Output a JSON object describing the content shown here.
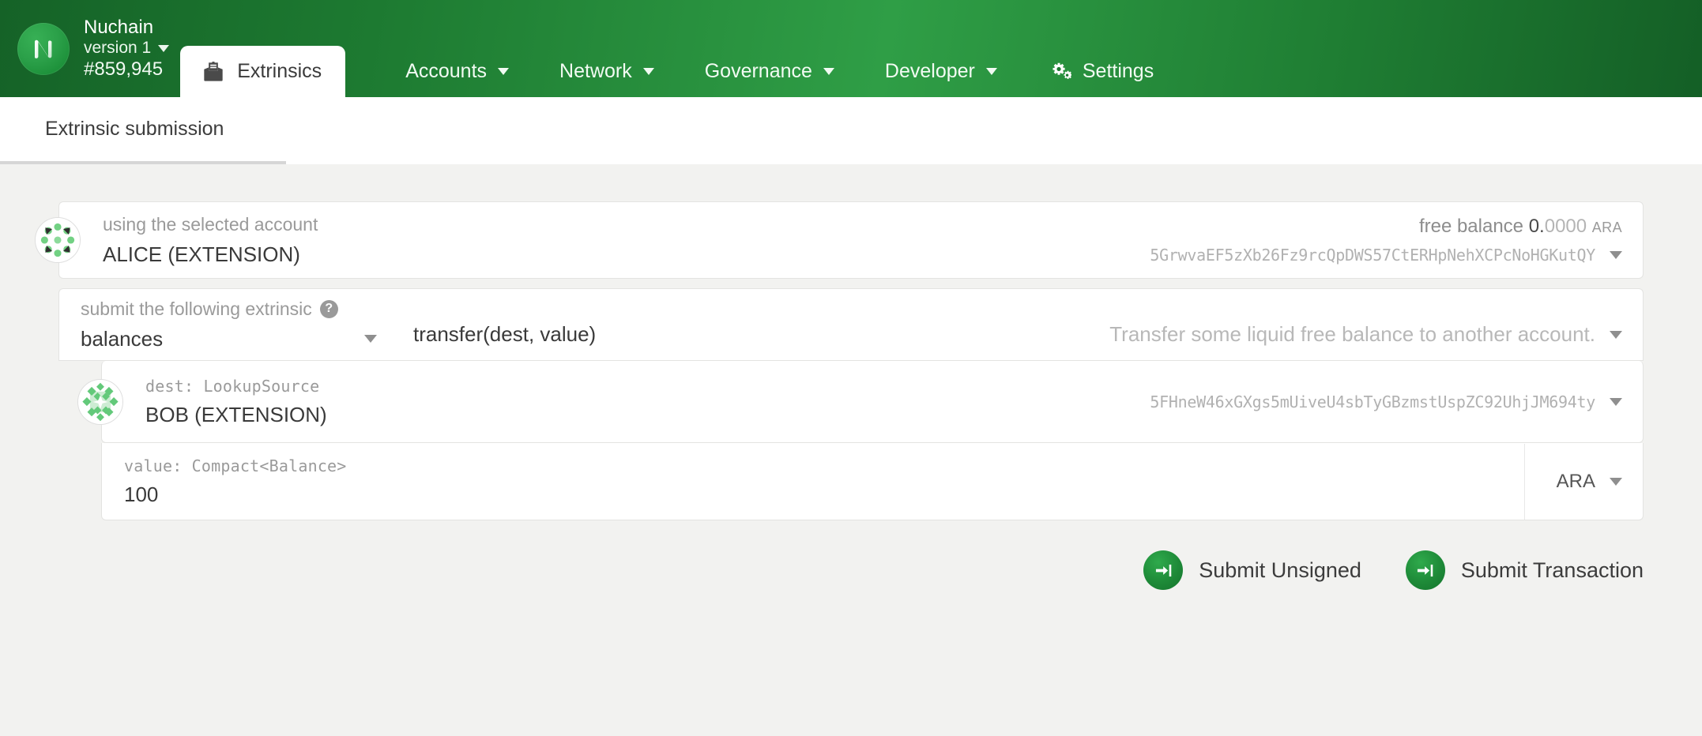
{
  "header": {
    "logo_icon": "nuchain-logo-icon",
    "chain_name": "Nuchain",
    "version": "version 1",
    "block_number": "#859,945",
    "active_tab": {
      "label": "Extrinsics",
      "icon": "envelope-open-text-icon"
    },
    "nav": [
      {
        "label": "Accounts",
        "has_caret": true,
        "icon": null
      },
      {
        "label": "Network",
        "has_caret": true,
        "icon": null
      },
      {
        "label": "Governance",
        "has_caret": true,
        "icon": null
      },
      {
        "label": "Developer",
        "has_caret": true,
        "icon": null
      },
      {
        "label": "Settings",
        "has_caret": false,
        "icon": "gears-icon"
      }
    ]
  },
  "subheader": {
    "tab_label": "Extrinsic submission"
  },
  "account_row": {
    "label": "using the selected account",
    "value": "ALICE (EXTENSION)",
    "balance_label": "free balance",
    "balance_int": "0.",
    "balance_dec": "0000",
    "balance_unit": "ARA",
    "address": "5GrwvaEF5zXb26Fz9rcQpDWS57CtERHpNehXCPcNoHGKutQY",
    "identicon": "alice-identicon"
  },
  "extrinsic_row": {
    "label": "submit the following extrinsic",
    "help_glyph": "?",
    "section": "balances",
    "method": "transfer(dest, value)",
    "description": "Transfer some liquid free balance to another account."
  },
  "dest_row": {
    "label": "dest: LookupSource",
    "value": "BOB (EXTENSION)",
    "address": "5FHneW46xGXgs5mUiveU4sbTyGBzmstUspZC92UhjJM694ty",
    "identicon": "bob-identicon"
  },
  "value_row": {
    "label": "value: Compact<Balance>",
    "value": "100",
    "unit": "ARA"
  },
  "actions": {
    "submit_unsigned": "Submit Unsigned",
    "submit_transaction": "Submit Transaction",
    "icon": "sign-in-arrow-icon"
  },
  "colors": {
    "brand_green": "#2f9e46",
    "brand_green_dark": "#156227",
    "page_bg": "#f2f2f0",
    "card_bg": "#ffffff",
    "text_primary": "#3a3a3a",
    "text_muted": "#9a9a9a"
  }
}
